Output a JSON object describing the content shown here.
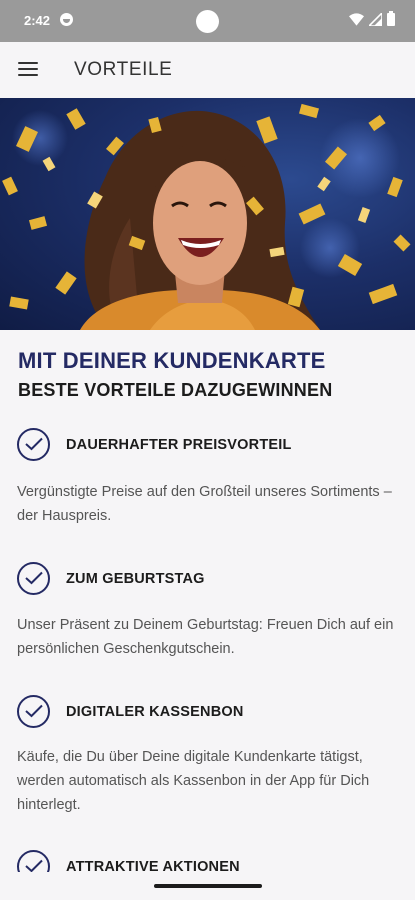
{
  "status_bar": {
    "time": "2:42"
  },
  "app_bar": {
    "title": "VORTEILE",
    "menu_icon": "hamburger-menu-icon"
  },
  "hero": {
    "image": "laughing woman with gold confetti"
  },
  "headline": {
    "line1": "MIT DEINER KUNDENKARTE",
    "line2": "BESTE VORTEILE DAZUGEWINNEN"
  },
  "benefits": [
    {
      "icon": "check-circle-icon",
      "title": "DAUERHAFTER PREISVORTEIL",
      "text": "Vergünstigte Preise auf den Großteil unseres Sortiments – der Hauspreis."
    },
    {
      "icon": "check-circle-icon",
      "title": "ZUM GEBURTSTAG",
      "text": "Unser Präsent zu Deinem Geburtstag: Freuen Dich auf ein persönlichen Geschenkgutschein."
    },
    {
      "icon": "check-circle-icon",
      "title": "DIGITALER KASSENBON",
      "text": "Käufe, die Du über Deine digitale Kundenkarte tätigst, werden automatisch als Kassenbon in der App für Dich hinterlegt."
    },
    {
      "icon": "check-circle-icon",
      "title": "ATTRAKTIVE AKTIONEN",
      "text": ""
    }
  ],
  "colors": {
    "accent": "#242a64",
    "status_bar": "#9a9a9a",
    "background": "#f6f5f7"
  }
}
